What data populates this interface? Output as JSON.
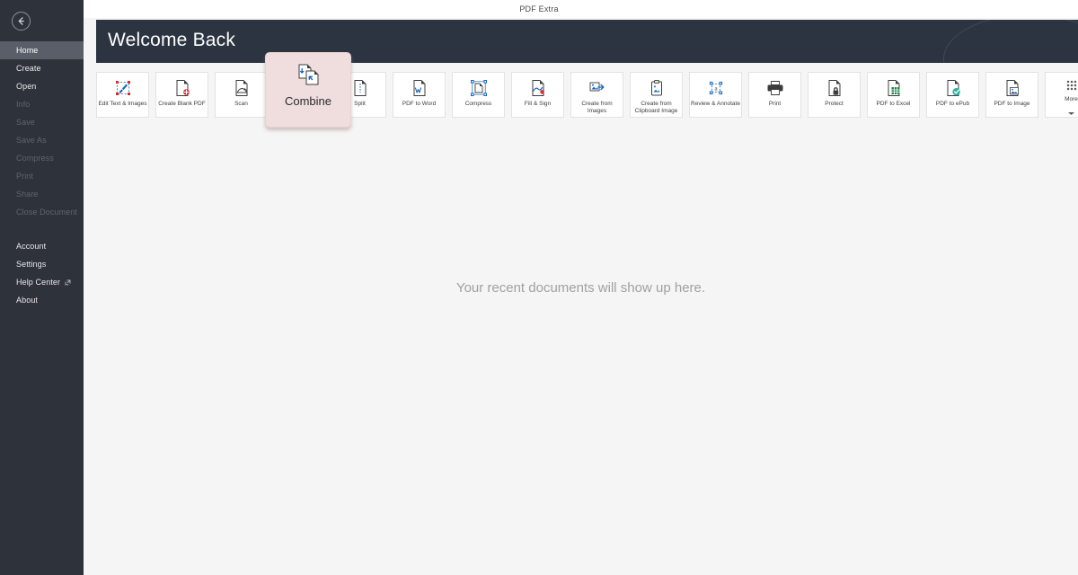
{
  "window": {
    "title": "PDF Extra"
  },
  "sidebar": {
    "back_icon": "back-arrow-icon",
    "items": [
      {
        "label": "Home",
        "state": "active"
      },
      {
        "label": "Create",
        "state": "enabled"
      },
      {
        "label": "Open",
        "state": "enabled"
      },
      {
        "label": "Info",
        "state": "disabled"
      },
      {
        "label": "Save",
        "state": "disabled"
      },
      {
        "label": "Save As",
        "state": "disabled"
      },
      {
        "label": "Compress",
        "state": "disabled"
      },
      {
        "label": "Print",
        "state": "disabled"
      },
      {
        "label": "Share",
        "state": "disabled"
      },
      {
        "label": "Close Document",
        "state": "disabled"
      }
    ],
    "bottom_items": [
      {
        "label": "Account",
        "state": "enabled",
        "icon": null
      },
      {
        "label": "Settings",
        "state": "enabled",
        "icon": null
      },
      {
        "label": "Help Center",
        "state": "enabled",
        "icon": "external-link-icon"
      },
      {
        "label": "About",
        "state": "enabled",
        "icon": null
      }
    ]
  },
  "header": {
    "title": "Welcome Back",
    "background": "#2b3440",
    "text_color": "#ffffff"
  },
  "toolbar": {
    "tiles": [
      {
        "label": "Edit Text & Images",
        "icon": "edit-text-images-icon"
      },
      {
        "label": "Create Blank PDF",
        "icon": "create-blank-pdf-icon"
      },
      {
        "label": "Scan",
        "icon": "scan-icon"
      },
      {
        "label": "Combine",
        "icon": "combine-icon"
      },
      {
        "label": "Split",
        "icon": "split-icon"
      },
      {
        "label": "PDF to Word",
        "icon": "pdf-to-word-icon"
      },
      {
        "label": "Compress",
        "icon": "compress-icon"
      },
      {
        "label": "Fill & Sign",
        "icon": "fill-sign-icon"
      },
      {
        "label": "Create from Images",
        "icon": "create-from-images-icon"
      },
      {
        "label": "Create from Clipboard Image",
        "icon": "create-from-clipboard-icon"
      },
      {
        "label": "Review & Annotate",
        "icon": "review-annotate-icon"
      },
      {
        "label": "Print",
        "icon": "print-icon"
      },
      {
        "label": "Protect",
        "icon": "protect-icon"
      },
      {
        "label": "PDF to Excel",
        "icon": "pdf-to-excel-icon"
      },
      {
        "label": "PDF to ePub",
        "icon": "pdf-to-epub-icon"
      },
      {
        "label": "PDF to Image",
        "icon": "pdf-to-image-icon"
      },
      {
        "label": "More",
        "icon": "grid-dots-icon"
      }
    ]
  },
  "hover_card": {
    "label": "Combine",
    "icon": "combine-icon",
    "background": "#f0dede"
  },
  "main": {
    "empty_state_text": "Your recent documents will show up here.",
    "background": "#f5f5f6"
  }
}
